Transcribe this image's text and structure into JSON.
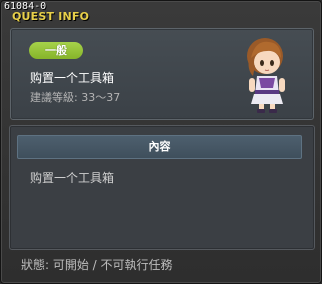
{
  "header": {
    "quest_id": "61084-0",
    "window_title": "QUEST INFO"
  },
  "quest": {
    "category": "一般",
    "name": "购置一个工具箱",
    "level_requirement": "建議等級: 33～37",
    "npc_icon": "npc-portrait-girl"
  },
  "content": {
    "tab_label": "內容",
    "description": "购置一个工具箱"
  },
  "status": {
    "text": "狀態: 可開始 / 不可執行任務"
  },
  "colors": {
    "title_yellow": "#e8d04a",
    "badge_green": "#96c43a",
    "panel_bg": "#3b4147"
  }
}
